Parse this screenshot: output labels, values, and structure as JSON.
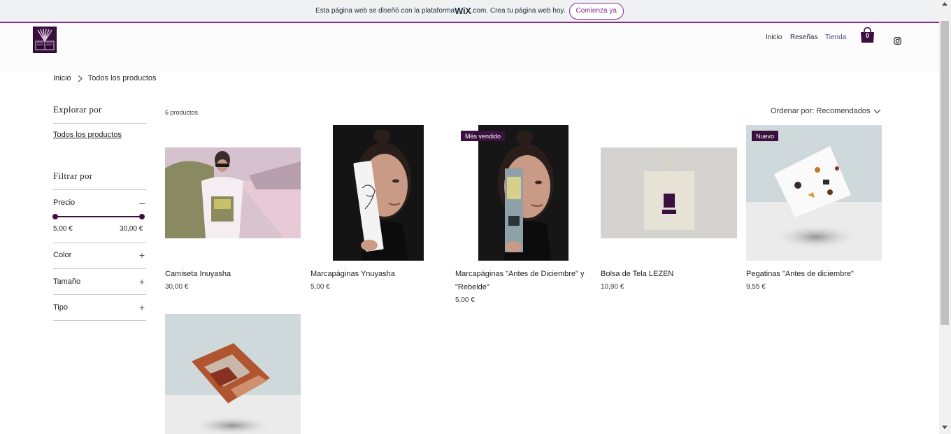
{
  "banner": {
    "text_before": "Esta página web se diseñó con la plataforma ",
    "wix_logo": "WiX",
    "wix_suffix": ".com",
    "text_after": ". Crea tu página web hoy.",
    "button": "Comienza ya"
  },
  "header": {
    "nav": [
      "Inicio",
      "Reseñas",
      "Tienda"
    ],
    "cart_count": "0"
  },
  "breadcrumb": {
    "home": "Inicio",
    "current": "Todos los productos"
  },
  "sidebar": {
    "explore_title": "Explorar por",
    "all_products_link": "Todos los productos",
    "filter_title": "Filtrar por",
    "filters": [
      {
        "label": "Precio",
        "symbol": "–"
      },
      {
        "label": "Color",
        "symbol": "+"
      },
      {
        "label": "Tamaño",
        "symbol": "+"
      },
      {
        "label": "Tipo",
        "symbol": "+"
      }
    ],
    "price_min": "5,00 €",
    "price_max": "30,00 €"
  },
  "products_header": {
    "count": "6 productos",
    "sort_label": "Ordenar por: Recomendados"
  },
  "products": [
    {
      "name": "Camiseta Inuyasha",
      "price": "30,00 €",
      "badge": ""
    },
    {
      "name": "Marcapáginas Ynuyasha",
      "price": "5,00 €",
      "badge": ""
    },
    {
      "name_line1": "Marcapáginas \"Antes de Diciembre\" y",
      "name_line2": "\"Rebelde\"",
      "price": "5,00 €",
      "badge": "Más vendido"
    },
    {
      "name": "Bolsa de Tela LEZEN",
      "price": "10,90 €",
      "badge": ""
    },
    {
      "name": "Pegatinas \"Antes de diciembre\"",
      "price": "9,55 €",
      "badge": "Nuevo"
    }
  ],
  "colors": {
    "brand": "#3b0f3f",
    "wix_accent": "#8a2a8c"
  },
  "icons": [
    "book-logo-icon",
    "cart-icon",
    "instagram-icon",
    "chevron-right-icon",
    "chevron-down-icon"
  ]
}
